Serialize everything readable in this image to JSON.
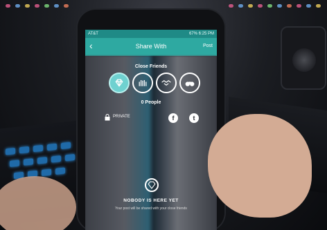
{
  "status_bar": {
    "carrier": "AT&T",
    "battery": "67%",
    "time": "6:25 PM"
  },
  "app_bar": {
    "back_icon": "chevron-left-icon",
    "title": "Share With",
    "action": "Post"
  },
  "group": {
    "title": "Close Friends",
    "options": [
      {
        "icon": "diamond-icon",
        "selected": true
      },
      {
        "icon": "hands-group-icon",
        "selected": false
      },
      {
        "icon": "handshake-icon",
        "selected": false
      },
      {
        "icon": "binoculars-icon",
        "selected": false
      }
    ],
    "people_count": "0 People"
  },
  "privacy": {
    "label": "PRIVATE",
    "icon": "lock-icon"
  },
  "share_targets": [
    {
      "icon": "facebook-icon",
      "glyph": "f"
    },
    {
      "icon": "twitter-icon",
      "glyph": "t"
    }
  ],
  "empty_state": {
    "icon": "diamond-icon",
    "title": "NOBODY IS HERE YET",
    "subtitle": "Your post will be shared with your close friends"
  },
  "colors": {
    "header": "#2ea9a1",
    "status_bar": "#1f8a86",
    "selected": "#6fd1d0"
  }
}
